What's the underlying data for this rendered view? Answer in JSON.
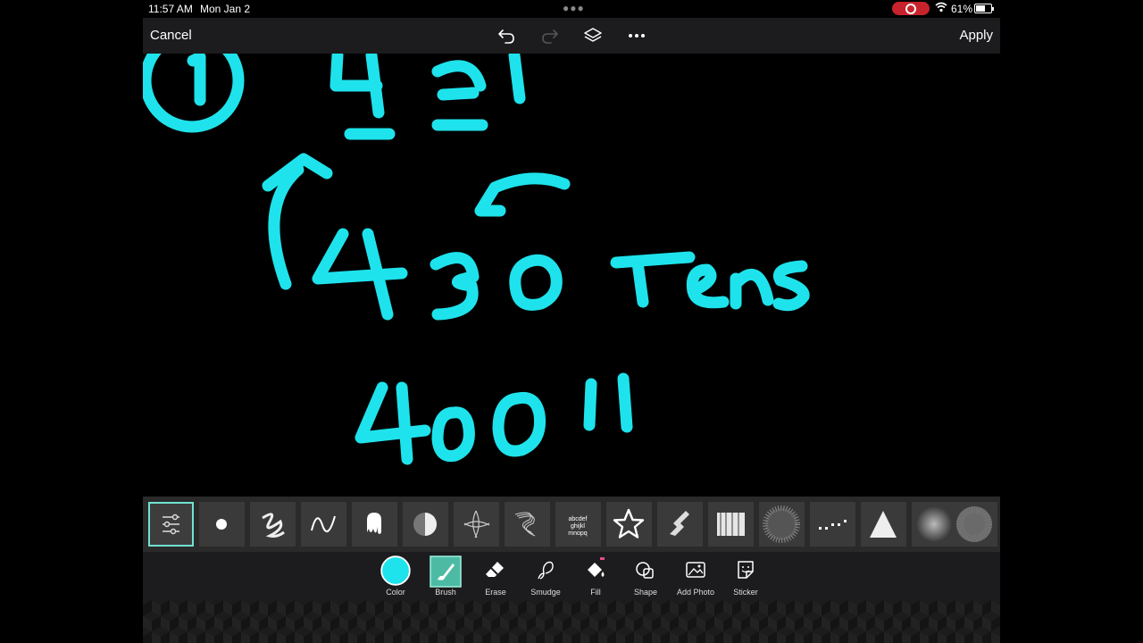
{
  "status_bar": {
    "time": "11:57 AM",
    "date": "Mon Jan 2",
    "battery": "61%"
  },
  "top_bar": {
    "cancel_label": "Cancel",
    "apply_label": "Apply",
    "icons": [
      "undo-icon",
      "redo-icon",
      "layers-icon",
      "more-icon"
    ]
  },
  "canvas": {
    "background": "#000000",
    "ink_color": "#1ee3ec"
  },
  "brushes": {
    "text_brush_sample": [
      "abcdef",
      "ghijkl",
      "mnopq"
    ],
    "items": [
      "settings",
      "dot",
      "scribble",
      "wave",
      "drip",
      "half-circle",
      "cross",
      "swirl",
      "text",
      "star",
      "splatter",
      "rough",
      "noise",
      "dotted",
      "triangle",
      "soft-round",
      "grain"
    ],
    "selected": "settings"
  },
  "tools": [
    {
      "label": "Color",
      "icon": "color-swatch-icon"
    },
    {
      "label": "Brush",
      "icon": "brush-icon"
    },
    {
      "label": "Erase",
      "icon": "eraser-icon"
    },
    {
      "label": "Smudge",
      "icon": "smudge-icon"
    },
    {
      "label": "Fill",
      "icon": "fill-bucket-icon"
    },
    {
      "label": "Shape",
      "icon": "shape-icon"
    },
    {
      "label": "Add Photo",
      "icon": "add-photo-icon"
    },
    {
      "label": "Sticker",
      "icon": "sticker-icon"
    }
  ],
  "colors": {
    "accent": "#6fe3d1",
    "current_color": "#1ee3ec",
    "record": "#c8232c"
  }
}
